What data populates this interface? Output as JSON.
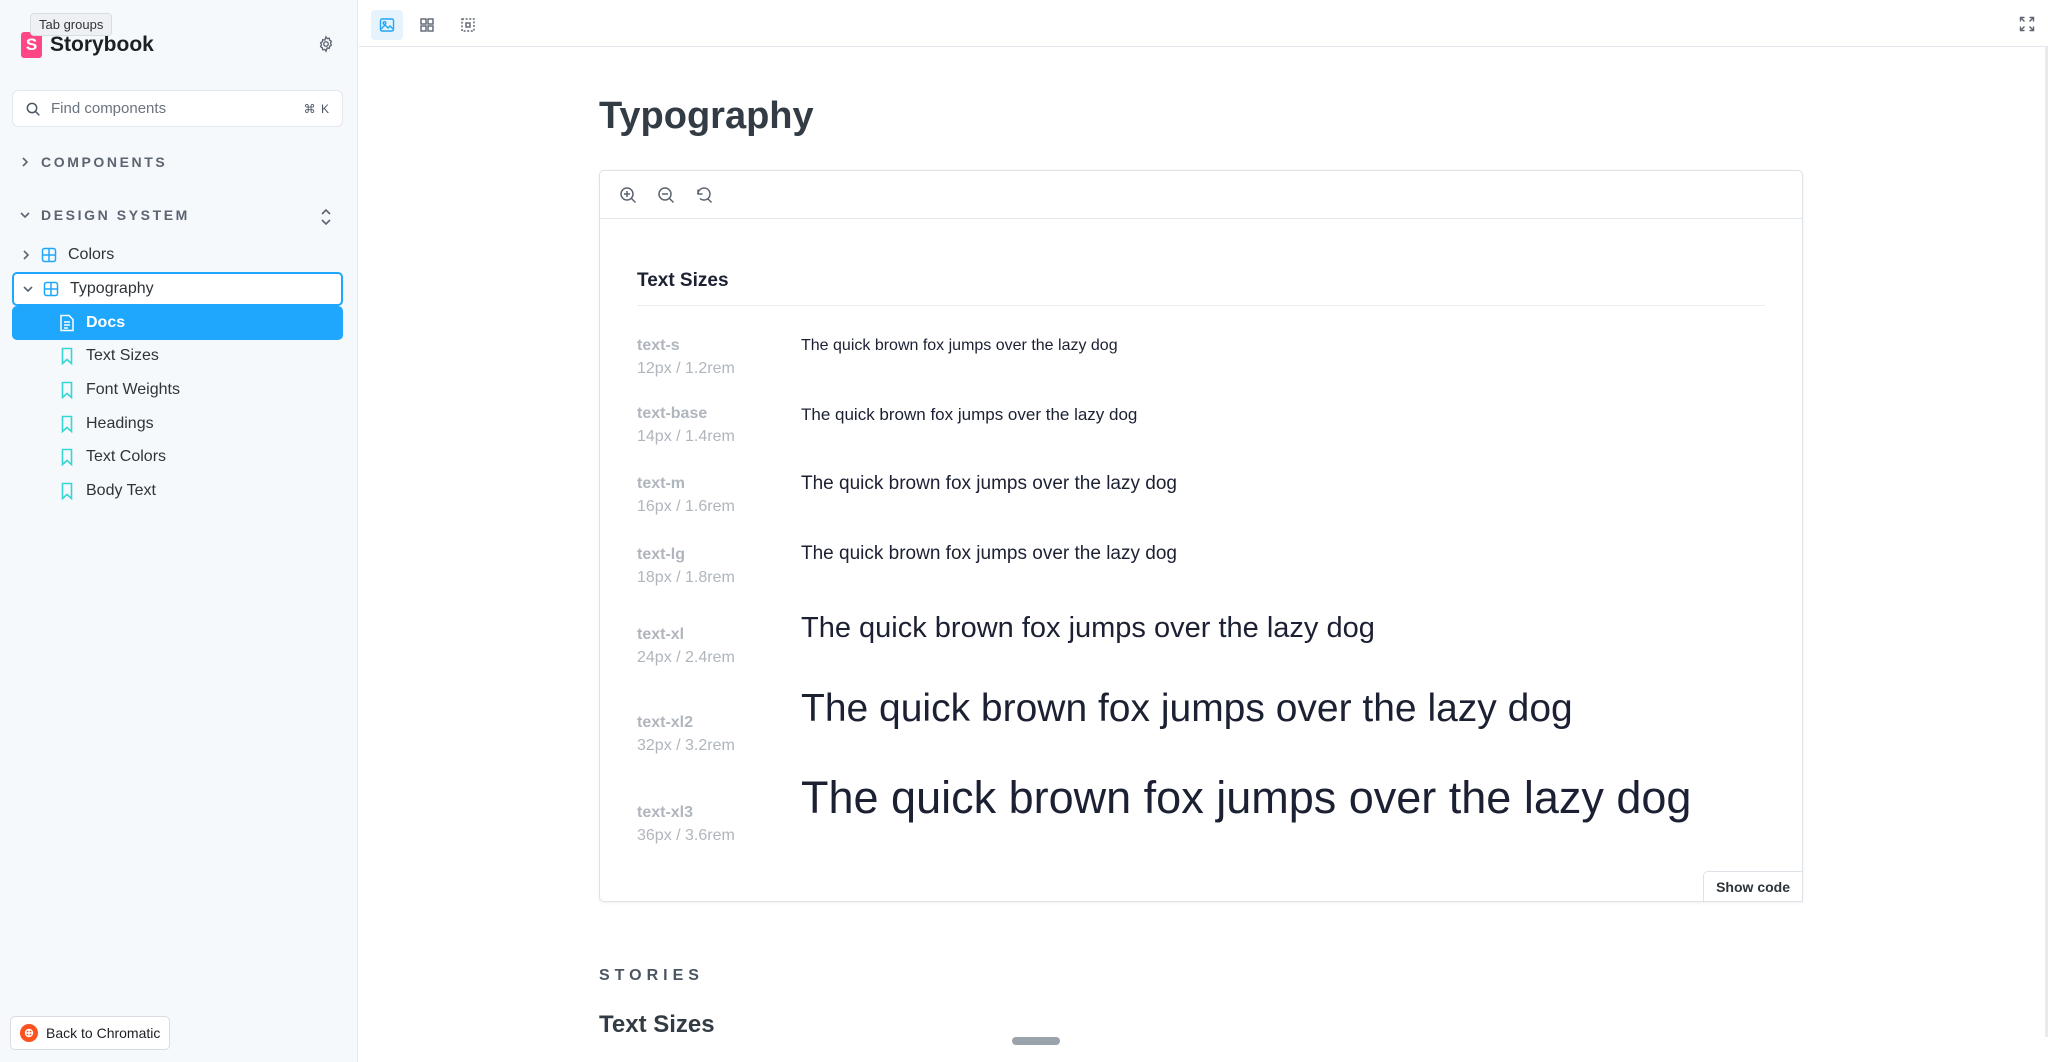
{
  "tooltip": {
    "text": "Tab groups"
  },
  "sidebar": {
    "brand": {
      "logo_letter": "S",
      "name": "Storybook"
    },
    "search": {
      "placeholder": "Find components",
      "shortcut": "⌘ K"
    },
    "sections": {
      "components": "COMPONENTS",
      "design_system": "DESIGN SYSTEM"
    },
    "tree": {
      "colors": "Colors",
      "typography": "Typography",
      "docs": "Docs",
      "stories": [
        "Text Sizes",
        "Font Weights",
        "Headings",
        "Text Colors",
        "Body Text"
      ]
    },
    "back_button": "Back to Chromatic"
  },
  "colors": {
    "accent": "#1ea7fd",
    "brand": "#ff4785",
    "chromatic": "#fc521f"
  },
  "doc": {
    "title": "Typography",
    "section_title": "Text Sizes",
    "text_sizes": [
      {
        "name": "text-s",
        "size": "12px / 1.2rem",
        "sample": "The quick brown fox jumps over the lazy dog"
      },
      {
        "name": "text-base",
        "size": "14px / 1.4rem",
        "sample": "The quick brown fox jumps over the lazy dog"
      },
      {
        "name": "text-m",
        "size": "16px / 1.6rem",
        "sample": "The quick brown fox jumps over the lazy dog"
      },
      {
        "name": "text-lg",
        "size": "18px / 1.8rem",
        "sample": "The quick brown fox jumps over the lazy dog"
      },
      {
        "name": "text-xl",
        "size": "24px / 2.4rem",
        "sample": "The quick brown fox jumps over the lazy dog"
      },
      {
        "name": "text-xl2",
        "size": "32px / 3.2rem",
        "sample": "The quick brown fox jumps over the lazy dog"
      },
      {
        "name": "text-xl3",
        "size": "36px / 3.6rem",
        "sample": "The quick brown fox jumps over the lazy dog"
      }
    ],
    "show_code": "Show code",
    "stories_label": "STORIES",
    "stories_subtitle": "Text Sizes"
  }
}
